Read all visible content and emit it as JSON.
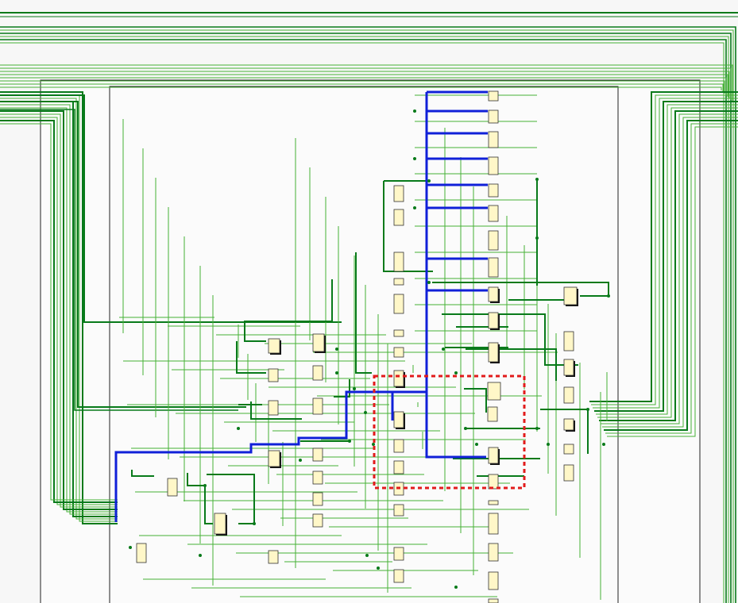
{
  "colors": {
    "background": "#f7f7f7",
    "net_dark": "#087a1a",
    "net_light": "#46b136",
    "net_highlight": "#1020d8",
    "selection_box": "#e21b1b",
    "cell_fill": "#fff7c8",
    "cell_border": "#333333",
    "boundary": "#222222"
  },
  "view": {
    "type": "netlist-schematic",
    "selection_style": "dashed",
    "highlighted_net_style": "solid"
  }
}
